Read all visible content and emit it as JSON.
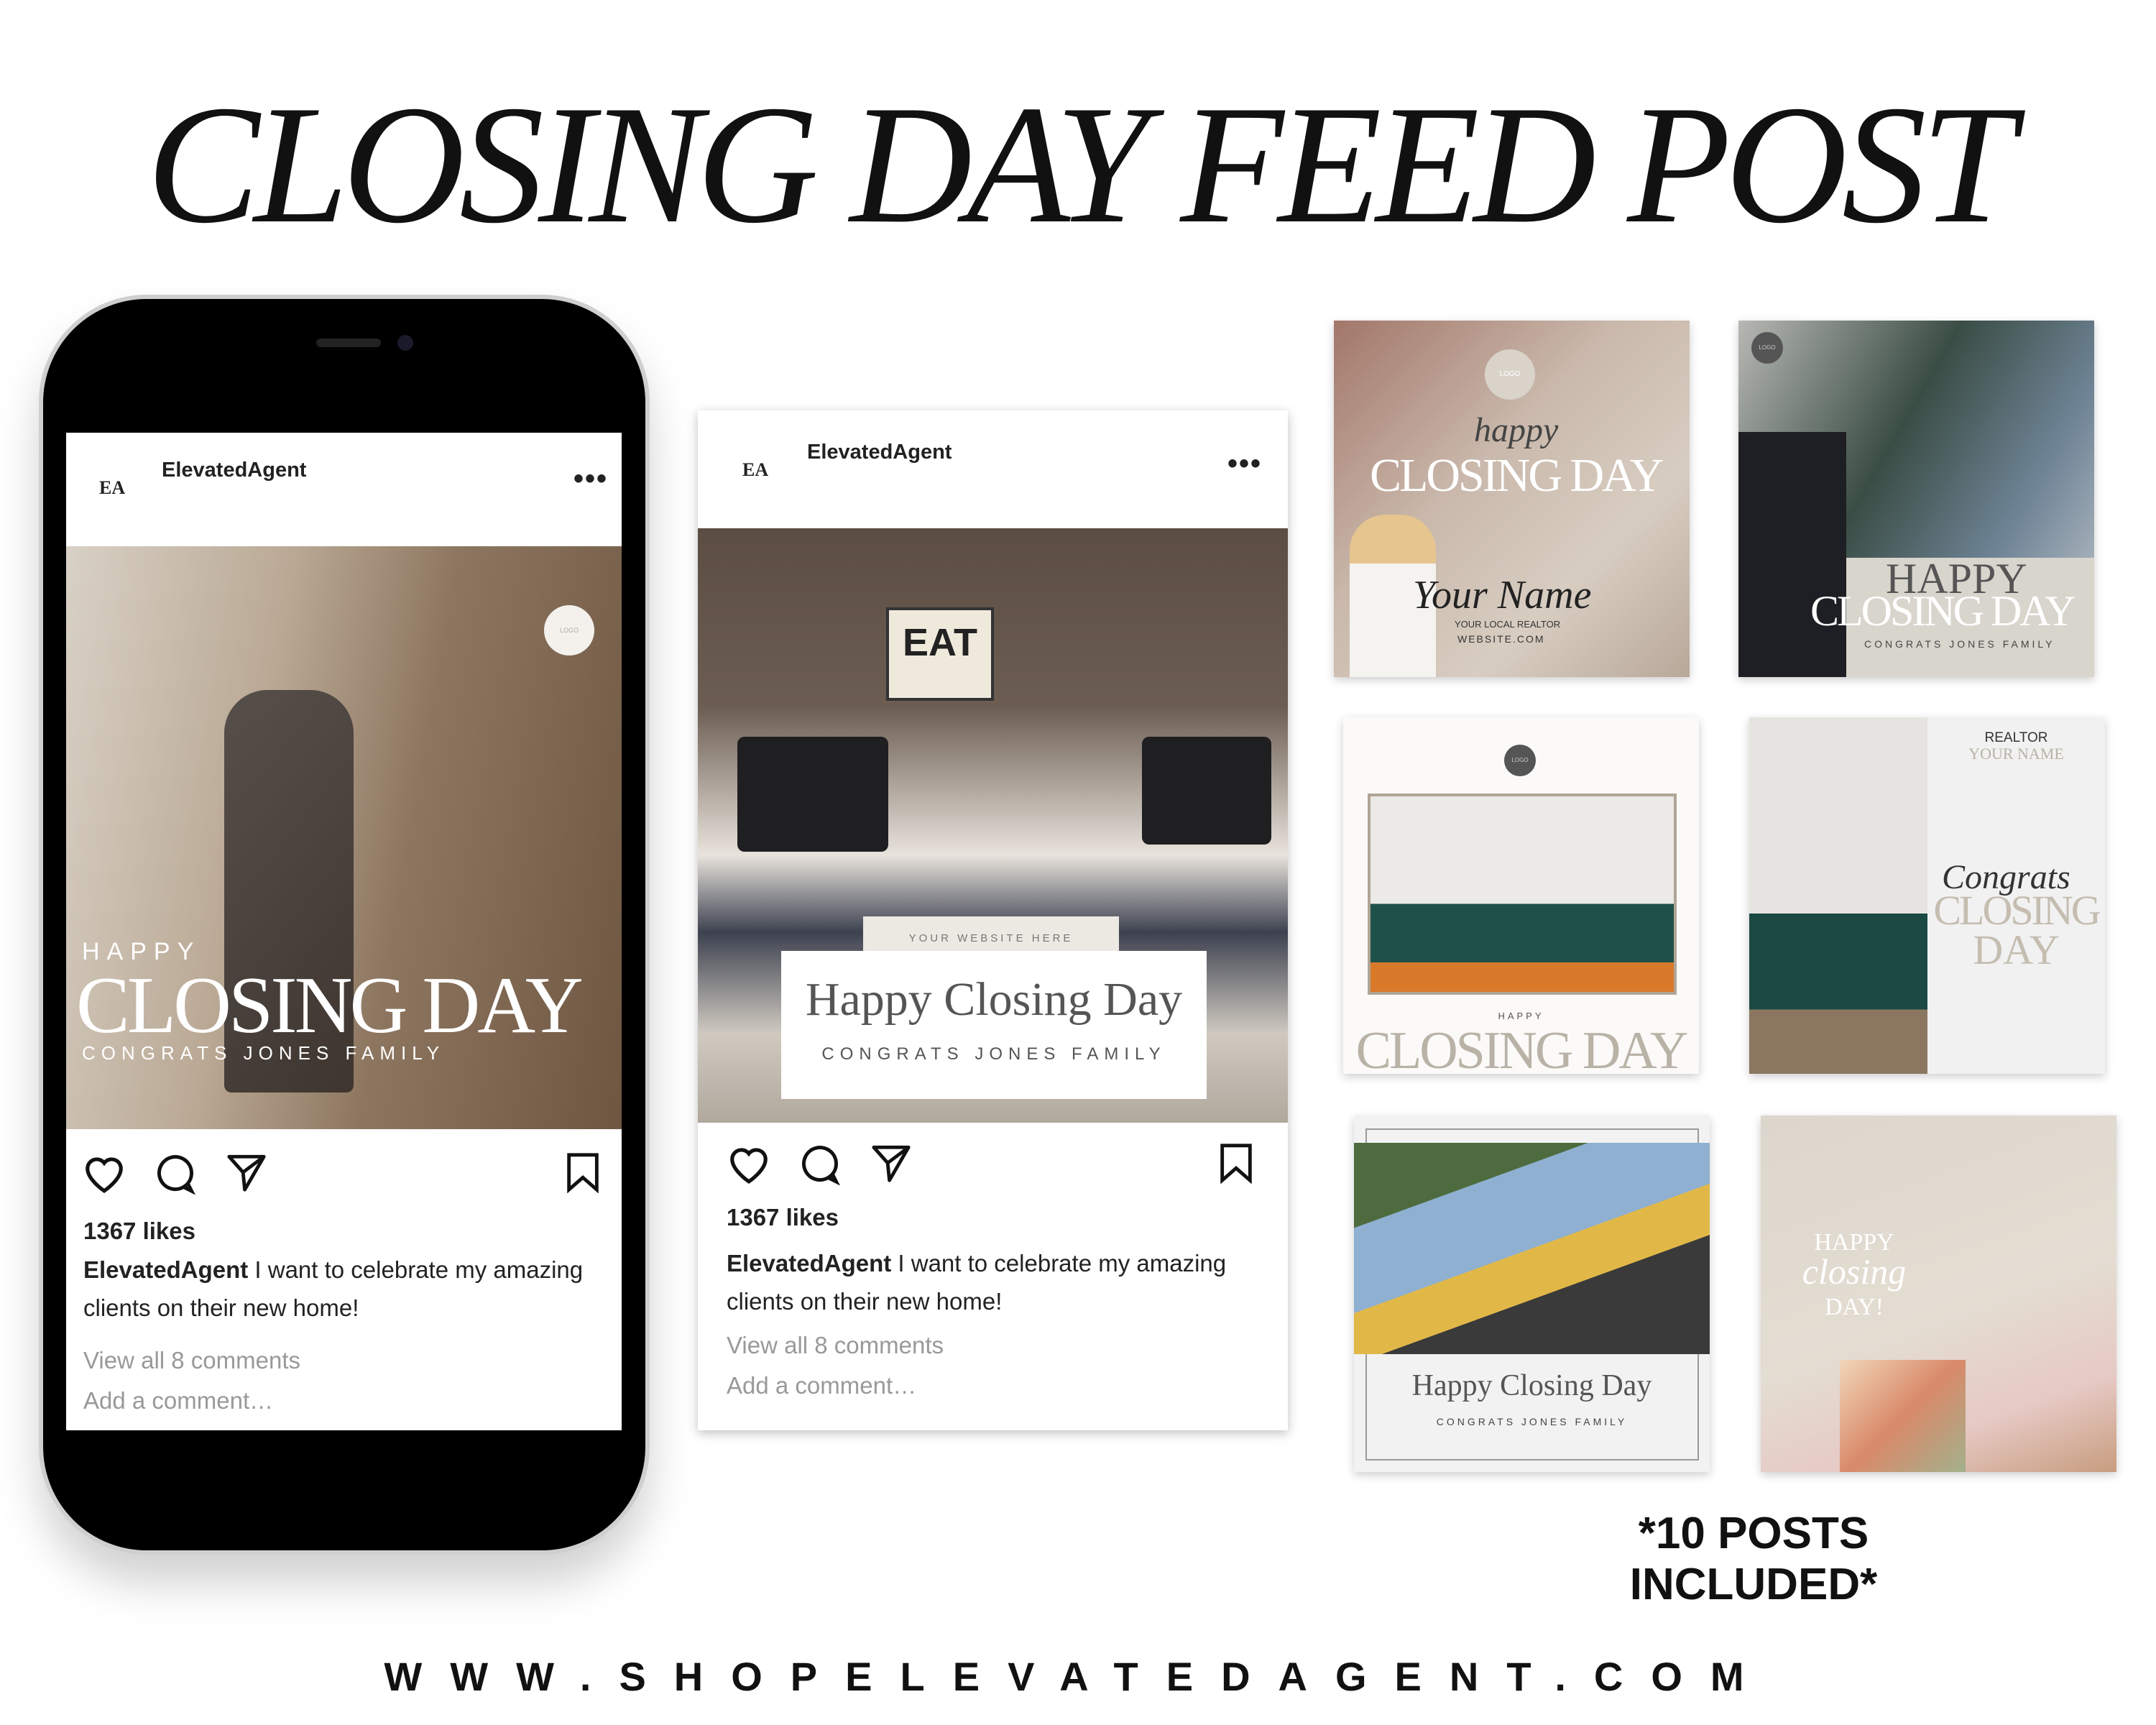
{
  "title": "CLOSING DAY FEED POST",
  "included": "*10 POSTS INCLUDED*",
  "url": "WWW.SHOPELEVATEDAGENT.COM",
  "phone_post": {
    "logo_initials": "EA",
    "username": "ElevatedAgent",
    "more": "•••",
    "logo_badge": "LOGO",
    "overlay": {
      "line1": "HAPPY",
      "line2": "CLOSING DAY",
      "line3": "CONGRATS JONES FAMILY"
    },
    "likes": "1367 likes",
    "caption_user": "ElevatedAgent",
    "caption_text": " I want to celebrate my amazing clients on their new home!",
    "view_comments": "View all 8 comments",
    "add_comment": "Add a comment…"
  },
  "card_post": {
    "logo_initials": "EA",
    "username": "ElevatedAgent",
    "more": "•••",
    "overlay": {
      "website": "YOUR WEBSITE HERE",
      "headline": "Happy Closing Day",
      "sub": "CONGRATS JONES FAMILY"
    },
    "photo_text": {
      "sign": "EAT"
    },
    "likes": "1367 likes",
    "caption_user": "ElevatedAgent",
    "caption_text": " I want to celebrate my amazing clients on their new home!",
    "view_comments": "View all 8 comments",
    "add_comment": "Add a comment…"
  },
  "thumbs": [
    {
      "logo": "LOGO",
      "script": "happy",
      "headline": "CLOSING DAY",
      "signature": "Your Name",
      "role": "YOUR LOCAL REALTOR",
      "website": "WEBSITE.COM"
    },
    {
      "logo": "LOGO",
      "line1": "HAPPY",
      "line2": "CLOSING DAY",
      "sub": "CONGRATS JONES FAMILY"
    },
    {
      "logo": "LOGO",
      "small": "HAPPY",
      "headline": "CLOSING DAY"
    },
    {
      "role": "REALTOR",
      "name": "YOUR NAME",
      "script": "Congrats",
      "line1": "CLOSING",
      "line2": "DAY"
    },
    {
      "headline": "Happy Closing Day",
      "sub": "CONGRATS JONES FAMILY"
    },
    {
      "line1": "HAPPY",
      "script": "closing",
      "line3": "DAY!"
    }
  ],
  "colors": {
    "accent_taupe": "#b9b2a6",
    "text_dark": "#222222",
    "muted": "#999999"
  }
}
